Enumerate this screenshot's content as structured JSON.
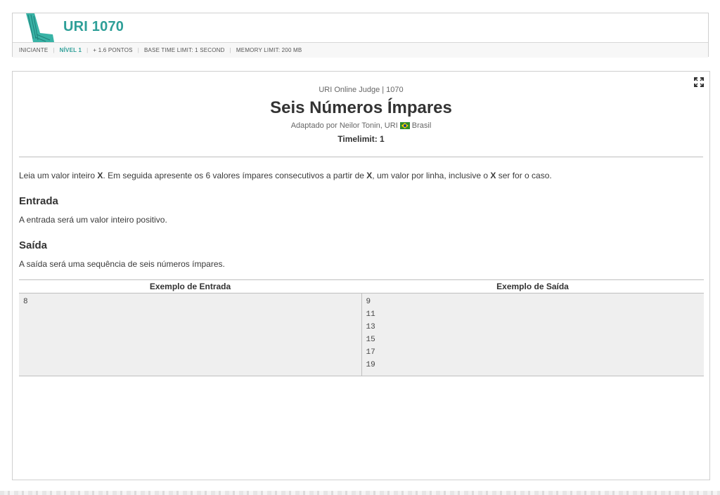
{
  "header": {
    "problem_code": "URI 1070",
    "meta": {
      "category": "INICIANTE",
      "level": "NÍVEL 1",
      "points": "+ 1.6 PONTOS",
      "time_limit": "BASE TIME LIMIT: 1 SECOND",
      "memory_limit": "MEMORY LIMIT: 200 MB"
    }
  },
  "problem": {
    "source_prefix": "URI Online Judge | ",
    "source_id": "1070",
    "title": "Seis Números Ímpares",
    "author_prefix": "Adaptado por Neilor Tonin, URI",
    "country": "Brasil",
    "timelimit": "Timelimit: 1",
    "statement": {
      "p1": "Leia um valor inteiro ",
      "x1": "X",
      "p2": ". Em seguida apresente os 6 valores ímpares consecutivos a partir de ",
      "x2": "X",
      "p3": ", um valor por linha, inclusive o ",
      "x3": "X",
      "p4": " ser for o caso."
    },
    "input_heading": "Entrada",
    "input_text": "A entrada será um valor inteiro positivo.",
    "output_heading": "Saída",
    "output_text": "A saída será uma sequência de seis números ímpares."
  },
  "examples": {
    "input_header": "Exemplo de Entrada",
    "output_header": "Exemplo de Saída",
    "input_lines": [
      "8"
    ],
    "output_lines": [
      "9",
      "11",
      "13",
      "15",
      "17",
      "19"
    ]
  },
  "colors": {
    "accent": "#2e9f98",
    "example_bg": "#efefef"
  },
  "icons": {
    "logo": "uri-logo-icon",
    "expand": "expand-icon",
    "flag": "brazil-flag-icon"
  }
}
